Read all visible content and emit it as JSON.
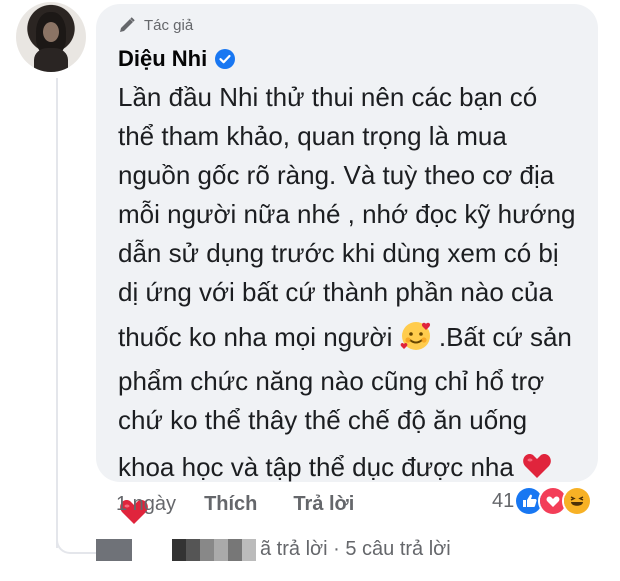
{
  "comment": {
    "author_badge": "Tác giả",
    "author_name": "Diệu Nhi",
    "lines": [
      "Lần đầu Nhi thử thui nên các bạn có",
      "thể tham khảo, quan trọng là mua",
      "nguồn gốc rõ ràng. Và tuỳ theo cơ địa",
      "mỗi người nữa nhé , nhớ đọc kỹ hướng",
      "dẫn sử dụng trước khi dùng xem có bị",
      "dị ứng với bất cứ thành phần nào của",
      "thuốc ko nha mọi người",
      " .Bất cứ sản",
      "phẩm chức năng nào cũng chỉ hổ trợ",
      "chứ ko thể thây thế chế độ ăn uống",
      "khoa học và tập thể dục được nha"
    ],
    "emojis": [
      "smiling-face-with-hearts",
      "red-heart",
      "red-heart"
    ]
  },
  "actions": {
    "time": "1 ngày",
    "like": "Thích",
    "reply": "Trả lời"
  },
  "reactions": {
    "count": "41",
    "types": [
      "like",
      "love",
      "haha"
    ]
  },
  "replies": {
    "text": "ã trả lời · 5 câu trả lời"
  },
  "colors": {
    "bubble": "#f0f2f5",
    "secondary_text": "#65676b",
    "verified": "#1877f2",
    "heart": "#e0243c"
  }
}
